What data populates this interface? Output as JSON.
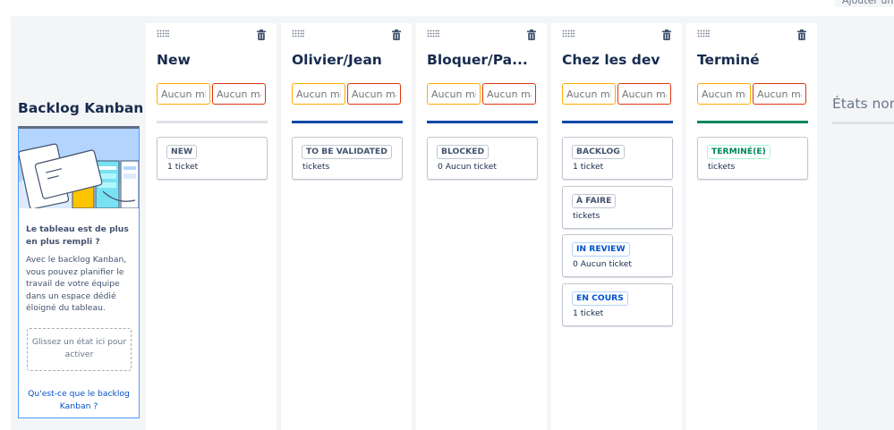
{
  "toolbar": {
    "add_label": "Ajouter une"
  },
  "backlog": {
    "title": "Backlog Kanban",
    "promo_title": "Le tableau est de plus en plus rempli ?",
    "promo_body": "Avec le backlog Kanban, vous pouvez planifier le travail de votre équipe dans un espace dédié éloigné du tableau.",
    "dropzone": "Glissez un état ici pour activer",
    "link": "Qu'est-ce que le backlog Kanban ?"
  },
  "columns": [
    {
      "title": "New",
      "min_placeholder": "Aucun min",
      "max_placeholder": "Aucun max",
      "bar_color": "#dfe1e6",
      "cards": [
        {
          "status": "NEW",
          "count": "1 ticket",
          "style": "grey"
        }
      ]
    },
    {
      "title": "Olivier/Jean",
      "min_placeholder": "Aucun min",
      "max_placeholder": "Aucun max",
      "bar_color": "#0747a6",
      "cards": [
        {
          "status": "TO BE VALIDATED",
          "count": "tickets",
          "style": "grey"
        }
      ]
    },
    {
      "title": "Bloquer/Pa...",
      "min_placeholder": "Aucun min",
      "max_placeholder": "Aucun max",
      "bar_color": "#0747a6",
      "cards": [
        {
          "status": "BLOCKED",
          "count": "0 Aucun ticket",
          "style": "grey"
        }
      ]
    },
    {
      "title": "Chez les dev",
      "min_placeholder": "Aucun min",
      "max_placeholder": "Aucun max",
      "bar_color": "#0747a6",
      "cards": [
        {
          "status": "BACKLOG",
          "count": "1 ticket",
          "style": "grey"
        },
        {
          "status": "À FAIRE",
          "count": "tickets",
          "style": "grey"
        },
        {
          "status": "IN REVIEW",
          "count": "0 Aucun ticket",
          "style": "blue"
        },
        {
          "status": "EN COURS",
          "count": "1 ticket",
          "style": "blue"
        }
      ]
    },
    {
      "title": "Terminé",
      "min_placeholder": "Aucun min",
      "max_placeholder": "Aucun max",
      "bar_color": "#00875a",
      "cards": [
        {
          "status": "TERMINÉ(E)",
          "count": "tickets",
          "style": "green"
        }
      ]
    }
  ],
  "unassigned": {
    "title": "États non"
  },
  "icons": {
    "handle": "drag-handle-icon",
    "trash": "trash-icon"
  },
  "colors": {
    "min_border": "#ffab00",
    "max_border": "#de350b",
    "link": "#0052cc"
  }
}
